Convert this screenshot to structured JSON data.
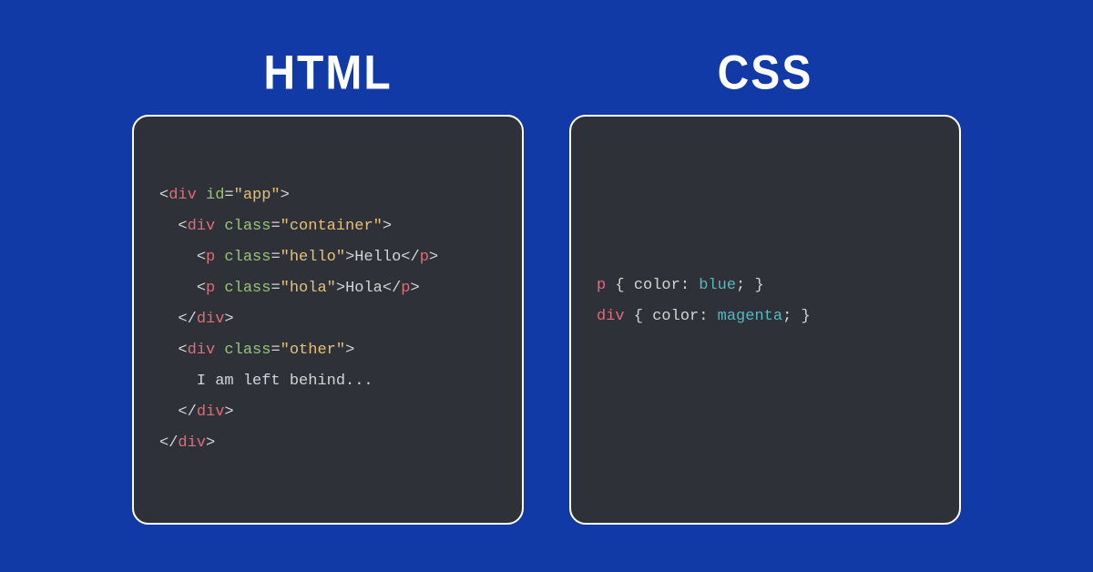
{
  "headings": {
    "html": "HTML",
    "css": "CSS"
  },
  "html_tokens": [
    [
      [
        0,
        "<"
      ],
      [
        1,
        "div"
      ],
      [
        0,
        " "
      ],
      [
        2,
        "id"
      ],
      [
        0,
        "="
      ],
      [
        3,
        "\"app\""
      ],
      [
        0,
        ">"
      ]
    ],
    [
      [
        4,
        "  "
      ],
      [
        0,
        "<"
      ],
      [
        1,
        "div"
      ],
      [
        0,
        " "
      ],
      [
        2,
        "class"
      ],
      [
        0,
        "="
      ],
      [
        3,
        "\"container\""
      ],
      [
        0,
        ">"
      ]
    ],
    [
      [
        4,
        "    "
      ],
      [
        0,
        "<"
      ],
      [
        1,
        "p"
      ],
      [
        0,
        " "
      ],
      [
        2,
        "class"
      ],
      [
        0,
        "="
      ],
      [
        3,
        "\"hello\""
      ],
      [
        0,
        ">"
      ],
      [
        4,
        "Hello"
      ],
      [
        0,
        "</"
      ],
      [
        1,
        "p"
      ],
      [
        0,
        ">"
      ]
    ],
    [
      [
        4,
        "    "
      ],
      [
        0,
        "<"
      ],
      [
        1,
        "p"
      ],
      [
        0,
        " "
      ],
      [
        2,
        "class"
      ],
      [
        0,
        "="
      ],
      [
        3,
        "\"hola\""
      ],
      [
        0,
        ">"
      ],
      [
        4,
        "Hola"
      ],
      [
        0,
        "</"
      ],
      [
        1,
        "p"
      ],
      [
        0,
        ">"
      ]
    ],
    [
      [
        4,
        "  "
      ],
      [
        0,
        "</"
      ],
      [
        1,
        "div"
      ],
      [
        0,
        ">"
      ]
    ],
    [
      [
        4,
        "  "
      ],
      [
        0,
        "<"
      ],
      [
        1,
        "div"
      ],
      [
        0,
        " "
      ],
      [
        2,
        "class"
      ],
      [
        0,
        "="
      ],
      [
        3,
        "\"other\""
      ],
      [
        0,
        ">"
      ]
    ],
    [
      [
        4,
        "    I am left behind..."
      ]
    ],
    [
      [
        4,
        "  "
      ],
      [
        0,
        "</"
      ],
      [
        1,
        "div"
      ],
      [
        0,
        ">"
      ]
    ],
    [
      [
        0,
        "</"
      ],
      [
        1,
        "div"
      ],
      [
        0,
        ">"
      ]
    ]
  ],
  "css_tokens": [
    [
      [
        5,
        "p"
      ],
      [
        0,
        " { "
      ],
      [
        6,
        "color"
      ],
      [
        0,
        ": "
      ],
      [
        7,
        "blue"
      ],
      [
        0,
        "; }"
      ]
    ],
    [
      [
        5,
        "div"
      ],
      [
        0,
        " { "
      ],
      [
        6,
        "color"
      ],
      [
        0,
        ": "
      ],
      [
        7,
        "magenta"
      ],
      [
        0,
        "; }"
      ]
    ]
  ]
}
